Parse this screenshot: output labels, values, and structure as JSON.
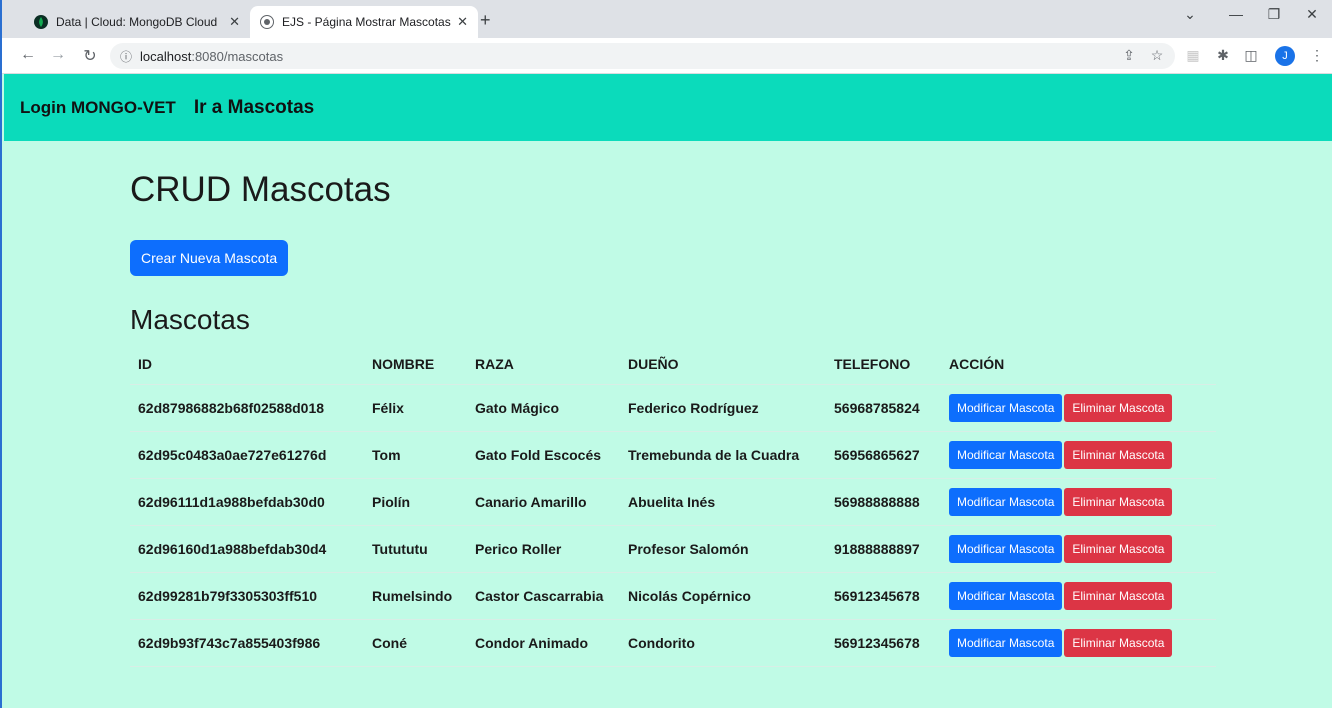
{
  "browser": {
    "tabs": [
      {
        "title": "Data | Cloud: MongoDB Cloud",
        "active": false
      },
      {
        "title": "EJS - Página Mostrar Mascotas",
        "active": true
      }
    ],
    "url_host": "localhost",
    "url_rest": ":8080/mascotas",
    "profile_initial": "J"
  },
  "nav": {
    "brand": "Login MONGO-VET",
    "link": "Ir a Mascotas"
  },
  "page": {
    "title": "CRUD Mascotas",
    "create_button": "Crear Nueva Mascota",
    "section_title": "Mascotas"
  },
  "table": {
    "headers": [
      "ID",
      "NOMBRE",
      "RAZA",
      "DUEÑO",
      "TELEFONO",
      "ACCIÓN"
    ],
    "edit_label": "Modificar Mascota",
    "delete_label": "Eliminar Mascota",
    "rows": [
      {
        "id": "62d87986882b68f02588d018",
        "nombre": "Félix",
        "raza": "Gato Mágico",
        "dueno": "Federico Rodríguez",
        "telefono": "56968785824"
      },
      {
        "id": "62d95c0483a0ae727e61276d",
        "nombre": "Tom",
        "raza": "Gato Fold Escocés",
        "dueno": "Tremebunda de la Cuadra",
        "telefono": "56956865627"
      },
      {
        "id": "62d96111d1a988befdab30d0",
        "nombre": "Piolín",
        "raza": "Canario Amarillo",
        "dueno": "Abuelita Inés",
        "telefono": "56988888888"
      },
      {
        "id": "62d96160d1a988befdab30d4",
        "nombre": "Tutututu",
        "raza": "Perico Roller",
        "dueno": "Profesor Salomón",
        "telefono": "91888888897"
      },
      {
        "id": "62d99281b79f3305303ff510",
        "nombre": "Rumelsindo",
        "raza": "Castor Cascarrabia",
        "dueno": "Nicolás Copérnico",
        "telefono": "56912345678"
      },
      {
        "id": "62d9b93f743c7a855403f986",
        "nombre": "Coné",
        "raza": "Condor Animado",
        "dueno": "Condorito",
        "telefono": "56912345678"
      }
    ]
  },
  "colors": {
    "navbar": "#0bdbbb",
    "background": "#c0fbe6",
    "primary": "#0d6efd",
    "danger": "#dc3545"
  }
}
